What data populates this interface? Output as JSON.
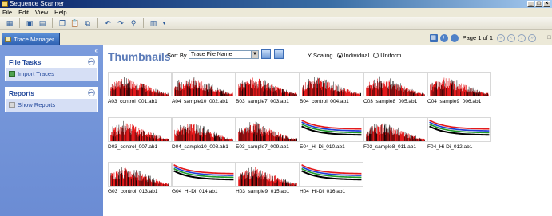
{
  "window": {
    "title": "Sequence Scanner"
  },
  "menu": [
    "File",
    "Edit",
    "View",
    "Help"
  ],
  "tab": {
    "label": "Trace Manager"
  },
  "pager": {
    "text": "Page 1 of 1"
  },
  "left_panel": {
    "file_tasks": {
      "title": "File Tasks",
      "item": "Import Traces"
    },
    "reports": {
      "title": "Reports",
      "item": "Show Reports"
    }
  },
  "main": {
    "title": "Thumbnails",
    "sort_label": "Sort By",
    "sort_value": "Trace File Name",
    "y_scaling_label": "Y Scaling",
    "y_scaling_options": [
      "Individual",
      "Uniform"
    ],
    "y_scaling_selected": "Individual"
  },
  "thumbnails": [
    {
      "name": "A03_control_001.ab1",
      "kind": "trace"
    },
    {
      "name": "A04_sample10_002.ab1",
      "kind": "trace"
    },
    {
      "name": "B03_sample7_003.ab1",
      "kind": "trace"
    },
    {
      "name": "B04_control_004.ab1",
      "kind": "trace"
    },
    {
      "name": "C03_sample8_005.ab1",
      "kind": "trace"
    },
    {
      "name": "C04_sample9_006.ab1",
      "kind": "trace"
    },
    {
      "name": "D03_control_007.ab1",
      "kind": "trace"
    },
    {
      "name": "D04_sample10_008.ab1",
      "kind": "trace"
    },
    {
      "name": "E03_sample7_009.ab1",
      "kind": "trace"
    },
    {
      "name": "E04_Hi-Di_010.ab1",
      "kind": "hidi"
    },
    {
      "name": "F03_sample8_011.ab1",
      "kind": "trace"
    },
    {
      "name": "F04_Hi-Di_012.ab1",
      "kind": "hidi"
    },
    {
      "name": "G03_control_013.ab1",
      "kind": "trace"
    },
    {
      "name": "G04_Hi-Di_014.ab1",
      "kind": "hidi"
    },
    {
      "name": "H03_sample9_015.ab1",
      "kind": "trace"
    },
    {
      "name": "H04_Hi-Di_016.ab1",
      "kind": "hidi"
    }
  ],
  "colors": {
    "trace_red": "#e41a1c",
    "trace_black": "#000000",
    "hidi_red": "#e41a1c",
    "hidi_blue": "#1f3fd6",
    "hidi_green": "#1e9a2a",
    "hidi_black": "#000000"
  }
}
